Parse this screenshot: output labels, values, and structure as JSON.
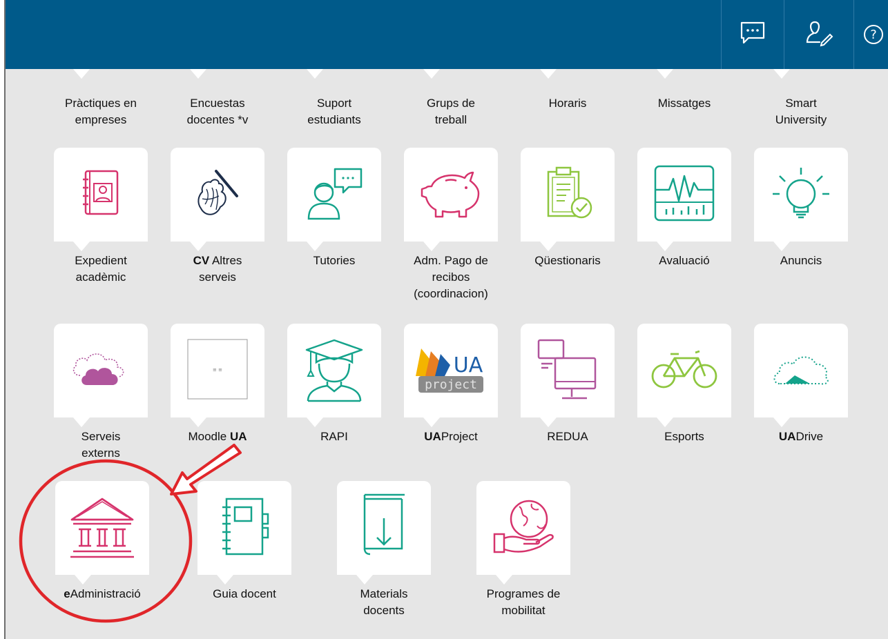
{
  "header": {
    "chat_icon": "chat-icon",
    "profile_icon": "user-edit-icon",
    "help_icon": "help-icon",
    "help_glyph": "?"
  },
  "top_row": [
    {
      "line1": "Pràctiques en",
      "line2": "empreses"
    },
    {
      "line1": "Encuestas",
      "line2": "docentes *v"
    },
    {
      "line1": "Suport",
      "line2": "estudiants"
    },
    {
      "line1": "Grups de",
      "line2": "treball"
    },
    {
      "line1": "Horaris",
      "line2": ""
    },
    {
      "line1": "Missatges",
      "line2": ""
    },
    {
      "line1": "Smart",
      "line2": "University"
    }
  ],
  "row2": [
    {
      "icon": "address-book-icon",
      "line1": "Expedient",
      "line2": "acadèmic",
      "line3": ""
    },
    {
      "icon": "hand-writing-icon",
      "bold": "CV",
      "line1": " Altres",
      "line2": "serveis",
      "line3": ""
    },
    {
      "icon": "tutor-chat-icon",
      "line1": "Tutories",
      "line2": "",
      "line3": ""
    },
    {
      "icon": "piggy-bank-icon",
      "line1": "Adm. Pago de",
      "line2": "recibos",
      "line3": "(coordinacion)"
    },
    {
      "icon": "clipboard-check-icon",
      "line1": "Qüestionaris",
      "line2": "",
      "line3": ""
    },
    {
      "icon": "monitor-chart-icon",
      "line1": "Avaluació",
      "line2": "",
      "line3": ""
    },
    {
      "icon": "lightbulb-icon",
      "line1": "Anuncis",
      "line2": "",
      "line3": ""
    }
  ],
  "row3": [
    {
      "icon": "clouds-icon",
      "line1": "Serveis",
      "line2": "externs"
    },
    {
      "icon": "moodle-logo-icon",
      "line1": "Moodle ",
      "bold_after": "UA",
      "line2": ""
    },
    {
      "icon": "graduate-icon",
      "line1": "RAPI",
      "line2": ""
    },
    {
      "icon": "uaproject-logo-icon",
      "bold": "UA",
      "line1": "Project",
      "line2": "",
      "logo_text1": "UA",
      "logo_text2": "project"
    },
    {
      "icon": "computers-icon",
      "line1": "REDUA",
      "line2": ""
    },
    {
      "icon": "bicycle-icon",
      "line1": "Esports",
      "line2": ""
    },
    {
      "icon": "cloud-drive-icon",
      "bold": "UA",
      "line1": "Drive",
      "line2": ""
    }
  ],
  "row4": [
    {
      "icon": "government-building-icon",
      "bold": "e",
      "line1": "Administració",
      "line2": ""
    },
    {
      "icon": "notebook-icon",
      "line1": "Guia docent",
      "line2": ""
    },
    {
      "icon": "book-download-icon",
      "line1": "Materials",
      "line2": "docents"
    },
    {
      "icon": "globe-hand-icon",
      "line1": "Programes de",
      "line2": "mobilitat"
    }
  ],
  "annotation": {
    "circle_color": "#e0262a",
    "arrow_color": "#e0262a"
  },
  "colors": {
    "header_bg": "#005a8a",
    "content_bg": "#e6e6e6",
    "pink": "#d6336c",
    "teal": "#14a38b",
    "green": "#8ec63f",
    "purple": "#b0559c",
    "navy": "#1e2e4a"
  }
}
